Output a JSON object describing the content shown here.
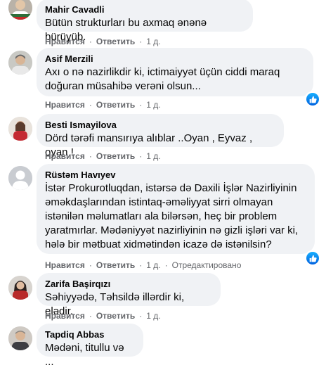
{
  "actions": {
    "like_label": "Нравится",
    "reply_label": "Ответить",
    "separator": "·",
    "edited_label": "Отредактировано"
  },
  "colors": {
    "bubble": "#f0f2f5",
    "meta": "#65676b",
    "like": "#1877f2"
  },
  "comments": [
    {
      "author": "Mahir Cavadli",
      "text": "Bütün strukturları bu axmaq ənənə bürüyüb.",
      "time": "1 д.",
      "liked": false,
      "avatar": "avatar-mahir"
    },
    {
      "author": "Asif Merzili",
      "text": "Axı o nə nazirlikdir ki, ictimaiyyət üçün ciddi maraq doğuran müsahibə verəni olsun...",
      "time": "1 д.",
      "liked": true,
      "avatar": "avatar-asif"
    },
    {
      "author": "Besti Ismayilova",
      "text": "Dörd tərəfi mansırıya alıblar ..Oyan , Eyvaz , oyan !",
      "time": "1 д.",
      "liked": false,
      "avatar": "avatar-besti"
    },
    {
      "author": "Rüstəm Havıyev",
      "text": "İstər Prokurotluqdan, istərsə də Daxili İşlər Nazirliyinin əməkdaşlarından istintaq-əməliyyat sirri olmayan istənilən məlumatları ala bilərsən, heç bir problem yaratmırlar. Mədəniyyət nazirliyinin nə gizli işləri var ki, hələ bir mətbuat xidmətindən icazə də istənilsin?",
      "time": "1 д.",
      "liked": true,
      "edited": true,
      "avatar": "avatar-default"
    },
    {
      "author": "Zarifa Başirqızı",
      "text": "Səhiyyədə, Təhsildə illərdir ki, elədir.",
      "time": "1 д.",
      "liked": false,
      "avatar": "avatar-zarifa"
    },
    {
      "author": "Tapdiq Abbas",
      "text": "Mədəni, titullu və ...",
      "time": "",
      "liked": false,
      "avatar": "avatar-tapdiq"
    }
  ]
}
